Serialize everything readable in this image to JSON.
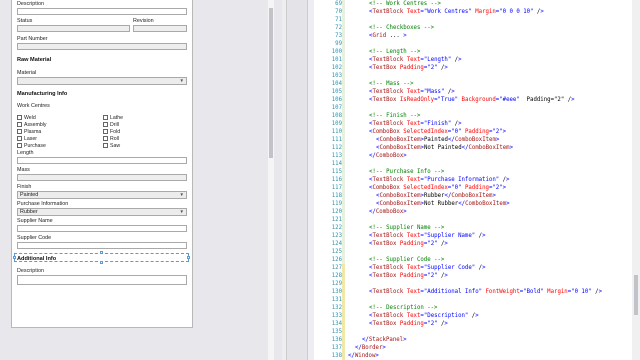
{
  "form": {
    "description_top": "Description",
    "status": "Status",
    "revision": "Revision",
    "part_number": "Part Number",
    "raw_material": "Raw Material",
    "material": "Material",
    "manufacturing_info": "Manufacturing Info",
    "work_centres": "Work Centres",
    "checkboxes": [
      "Weld",
      "Assembly",
      "Plasma",
      "Laser",
      "Purchase",
      "Lathe",
      "Drill",
      "Fold",
      "Roll",
      "Saw"
    ],
    "length": "Length",
    "mass": "Mass",
    "finish": "Finish",
    "finish_value": "Painted",
    "purchase_information": "Purchase Information",
    "purchase_value": "Rubber",
    "supplier_name": "Supplier Name",
    "supplier_code": "Supplier Code",
    "additional_info": "Additional Info",
    "description": "Description"
  },
  "editor": {
    "lines": [
      {
        "n": "69",
        "text": "<!-- Work Centres -->"
      },
      {
        "n": "70",
        "text": "<TextBlock Text=\"Work Centres\" Margin=\"0 0 0 10\" />"
      },
      {
        "n": "71",
        "text": ""
      },
      {
        "n": "72",
        "text": "<!-- Checkboxes -->"
      },
      {
        "n": "73",
        "text": "<Grid ... >"
      },
      {
        "n": "99",
        "text": ""
      },
      {
        "n": "100",
        "text": "<!-- Length -->"
      },
      {
        "n": "101",
        "text": "<TextBlock Text=\"Length\" />"
      },
      {
        "n": "102",
        "text": "<TextBox Padding=\"2\" />"
      },
      {
        "n": "103",
        "text": ""
      },
      {
        "n": "104",
        "text": "<!-- Mass -->"
      },
      {
        "n": "105",
        "text": "<TextBlock Text=\"Mass\" />"
      },
      {
        "n": "106",
        "text": "<TextBox IsReadOnly=\"True\" Background=\"#eee\"  Padding=\"2\" />"
      },
      {
        "n": "107",
        "text": ""
      },
      {
        "n": "108",
        "text": "<!-- Finish -->"
      },
      {
        "n": "109",
        "text": "<TextBlock Text=\"Finish\" />"
      },
      {
        "n": "110",
        "text": "<ComboBox SelectedIndex=\"0\" Padding=\"2\">"
      },
      {
        "n": "111",
        "text": "<ComboBoxItem>Painted</ComboBoxItem>"
      },
      {
        "n": "112",
        "text": "<ComboBoxItem>Not Painted</ComboBoxItem>"
      },
      {
        "n": "113",
        "text": "</ComboBox>"
      },
      {
        "n": "114",
        "text": ""
      },
      {
        "n": "115",
        "text": "<!-- Purchase Info -->"
      },
      {
        "n": "116",
        "text": "<TextBlock Text=\"Purchase Information\" />"
      },
      {
        "n": "117",
        "text": "<ComboBox SelectedIndex=\"0\" Padding=\"2\">"
      },
      {
        "n": "118",
        "text": "<ComboBoxItem>Rubber</ComboBoxItem>"
      },
      {
        "n": "119",
        "text": "<ComboBoxItem>Not Rubber</ComboBoxItem>"
      },
      {
        "n": "120",
        "text": "</ComboBox>"
      },
      {
        "n": "121",
        "text": ""
      },
      {
        "n": "122",
        "text": "<!-- Supplier Name -->"
      },
      {
        "n": "123",
        "text": "<TextBlock Text=\"Supplier Name\" />"
      },
      {
        "n": "124",
        "text": "<TextBox Padding=\"2\" />"
      },
      {
        "n": "125",
        "text": ""
      },
      {
        "n": "126",
        "text": "<!-- Supplier Code -->"
      },
      {
        "n": "127",
        "text": "<TextBlock Text=\"Supplier Code\" />"
      },
      {
        "n": "128",
        "text": "<TextBox Padding=\"2\" />"
      },
      {
        "n": "129",
        "text": ""
      },
      {
        "n": "130",
        "text": "<TextBlock Text=\"Additional Info\" FontWeight=\"Bold\" Margin=\"0 10\" />"
      },
      {
        "n": "131",
        "text": ""
      },
      {
        "n": "132",
        "text": "<!-- Description -->"
      },
      {
        "n": "133",
        "text": "<TextBlock Text=\"Description\" />"
      },
      {
        "n": "134",
        "text": "<TextBox Padding=\"2\" />"
      },
      {
        "n": "135",
        "text": ""
      },
      {
        "n": "136",
        "text": "</StackPanel>"
      },
      {
        "n": "137",
        "text": "</Border>"
      },
      {
        "n": "138",
        "text": "</Window>"
      }
    ]
  },
  "colors": {
    "line_number": "#2b91af",
    "tag": "#a31515",
    "attribute": "#ff0000",
    "value": "#0000ff",
    "comment": "#008000",
    "selection": "#5b9bd5"
  }
}
